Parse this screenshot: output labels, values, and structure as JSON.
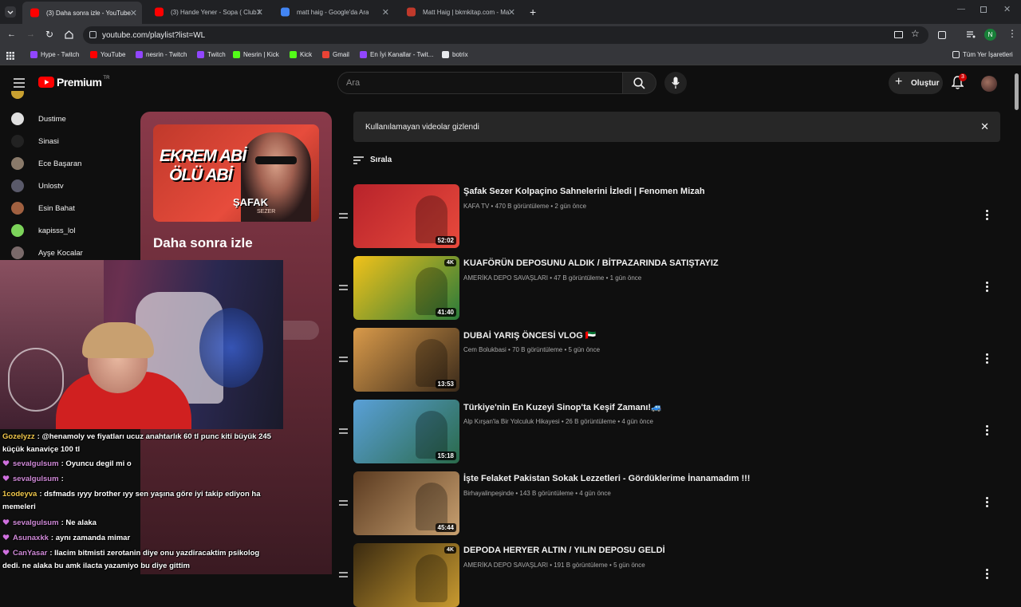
{
  "browser": {
    "tabs": [
      {
        "title": "(3) Daha sonra izle - YouTube",
        "color": "#ff0000",
        "active": true
      },
      {
        "title": "(3) Hande Yener - Sopa ( Club R",
        "color": "#ff0000",
        "active": false
      },
      {
        "title": "matt haig - Google'da Ara",
        "color": "#4285f4",
        "active": false
      },
      {
        "title": "Matt Haig | bkmkitap.com - Ma",
        "color": "#c0392b",
        "active": false
      }
    ],
    "url": "youtube.com/playlist?list=WL",
    "profile_initial": "N",
    "bookmarks": [
      "Hype - Twitch",
      "YouTube",
      "nesrin - Twitch",
      "Twitch",
      "Nesrin | Kick",
      "Kick",
      "Gmail",
      "En İyi Kanallar - Twit...",
      "botrix"
    ],
    "all_bookmarks": "Tüm Yer İşaretleri"
  },
  "youtube": {
    "logo_text": "Premium",
    "region": "TR",
    "search_placeholder": "Ara",
    "create_label": "Oluştur",
    "notification_count": "3",
    "sidebar": [
      {
        "label": "Dustime",
        "color": "#e0e0e0"
      },
      {
        "label": "Sinasi",
        "color": "#222222"
      },
      {
        "label": "Ece Başaran",
        "color": "#8a7a6a"
      },
      {
        "label": "Unlostv",
        "color": "#5a5a6a"
      },
      {
        "label": "Esin Bahat",
        "color": "#a06040"
      },
      {
        "label": "kapisss_lol",
        "color": "#7cd35a"
      },
      {
        "label": "Ayşe Kocalar",
        "color": "#7a6a6a"
      }
    ],
    "playlist": {
      "title": "Daha sonra izle",
      "thumb_line1": "EKREM ABİ",
      "thumb_line2": "ÖLÜ ABİ",
      "thumb_brand": "ŞAFAK",
      "thumb_brand2": "SEZER"
    },
    "notice": "Kullanılamayan videolar gizlendi",
    "sort_label": "Sırala",
    "videos": [
      {
        "title": "Şafak Sezer Kolpaçino Sahnelerini İzledi | Fenomen Mizah",
        "channel": "KAFA TV",
        "views": "470 B görüntüleme",
        "age": "2 gün önce",
        "duration": "52:02",
        "badge": "",
        "c1": "#b8232b",
        "c2": "#e84a3c"
      },
      {
        "title": "KUAFÖRÜN DEPOSUNU ALDIK / BİTPAZARINDA SATIŞTAYIZ",
        "channel": "AMERİKA DEPO SAVAŞLARI",
        "views": "47 B görüntüleme",
        "age": "1 gün önce",
        "duration": "41:40",
        "badge": "4K",
        "c1": "#f2c21a",
        "c2": "#2a7a3a"
      },
      {
        "title": "DUBAİ YARIŞ ÖNCESİ VLOG 🇦🇪",
        "channel": "Cem Bolukbasi",
        "views": "70 B görüntüleme",
        "age": "5 gün önce",
        "duration": "13:53",
        "badge": "",
        "c1": "#d99a4a",
        "c2": "#3a2a1a"
      },
      {
        "title": "Türkiye'nin En Kuzeyi Sinop'ta Keşif Zamanı!🚙",
        "channel": "Alp Kırşan'la Bir Yolculuk Hikayesi",
        "views": "26 B görüntüleme",
        "age": "4 gün önce",
        "duration": "15:18",
        "badge": "",
        "c1": "#5aa0d8",
        "c2": "#2a6a4a"
      },
      {
        "title": "İşte Felaket Pakistan Sokak Lezzetleri - Gördüklerime İnanamadım !!!",
        "channel": "Birhayalinpeşinde",
        "views": "143 B görüntüleme",
        "age": "4 gün önce",
        "duration": "45:44",
        "badge": "",
        "c1": "#5a3a20",
        "c2": "#c8a070"
      },
      {
        "title": "DEPODA HERYER ALTIN / YILIN DEPOSU GELDİ",
        "channel": "AMERİKA DEPO SAVAŞLARI",
        "views": "191 B görüntüleme",
        "age": "5 gün önce",
        "duration": "",
        "badge": "4K",
        "c1": "#3a2a10",
        "c2": "#c89a30"
      }
    ]
  },
  "chat": [
    {
      "user": "Gozelyzz",
      "color": "#f2c94c",
      "text": ": @henamoly ve fiyatları ucuz anahtarlık 60 tl punc kiti büyük 245 küçük kanaviçe 100 tl",
      "heart": false
    },
    {
      "user": "sevalgulsum",
      "color": "#d08ad8",
      "text": ": Oyuncu degil mi o",
      "heart": true
    },
    {
      "user": "sevalgulsum",
      "color": "#d08ad8",
      "text": ":",
      "heart": true
    },
    {
      "user": "1codeyva",
      "color": "#f2c94c",
      "text": ": dsfmads ıyyy brother ıyy sen yaşına göre iyi takip ediyon ha memeleri",
      "heart": false
    },
    {
      "user": "sevalgulsum",
      "color": "#d08ad8",
      "text": ": Ne alaka",
      "heart": true
    },
    {
      "user": "Asunaxkk",
      "color": "#d08ad8",
      "text": ": aynı zamanda mimar",
      "heart": true
    },
    {
      "user": "CanYasar",
      "color": "#d08ad8",
      "text": ": Ilacim bitmisti zerotanin diye onu yazdiracaktim psikolog dedi. ne alaka bu amk ilacta yazamiyo bu diye gittim",
      "heart": true
    }
  ]
}
